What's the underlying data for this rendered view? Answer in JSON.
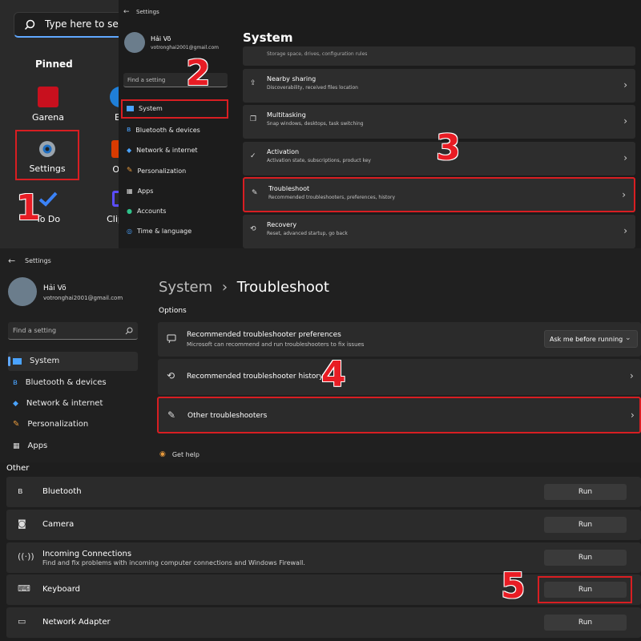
{
  "panel1": {
    "search_placeholder": "Type here to sea",
    "pinned_label": "Pinned",
    "apps": [
      {
        "label": "Garena"
      },
      {
        "label": "Ed"
      },
      {
        "label": "Settings"
      },
      {
        "label": "Offi"
      },
      {
        "label": "To Do"
      },
      {
        "label": "Clipch"
      }
    ]
  },
  "panel2": {
    "window_title": "Settings",
    "user_name": "Hải Võ",
    "user_email": "votronghai2001@gmail.com",
    "find_placeholder": "Find a setting",
    "nav": [
      "System",
      "Bluetooth & devices",
      "Network & internet",
      "Personalization",
      "Apps",
      "Accounts",
      "Time & language"
    ],
    "page_title": "System",
    "top_partial": "Storage space, drives, configuration rules",
    "cards": [
      {
        "title": "Nearby sharing",
        "subtitle": "Discoverability, received files location"
      },
      {
        "title": "Multitasking",
        "subtitle": "Snap windows, desktops, task switching"
      },
      {
        "title": "Activation",
        "subtitle": "Activation state, subscriptions, product key"
      },
      {
        "title": "Troubleshoot",
        "subtitle": "Recommended troubleshooters, preferences, history"
      },
      {
        "title": "Recovery",
        "subtitle": "Reset, advanced startup, go back"
      }
    ]
  },
  "panel3": {
    "window_title": "Settings",
    "user_name": "Hải Võ",
    "user_email": "votronghai2001@gmail.com",
    "find_placeholder": "Find a setting",
    "nav": [
      "System",
      "Bluetooth & devices",
      "Network & internet",
      "Personalization",
      "Apps"
    ],
    "breadcrumb_parent": "System",
    "breadcrumb_sep": "›",
    "breadcrumb_current": "Troubleshoot",
    "section_label": "Options",
    "pref_title": "Recommended troubleshooter preferences",
    "pref_subtitle": "Microsoft can recommend and run troubleshooters to fix issues",
    "pref_dropdown": "Ask me before running",
    "history_title": "Recommended troubleshooter history",
    "other_title": "Other troubleshooters",
    "get_help": "Get help"
  },
  "panel4": {
    "section_label": "Other",
    "run_label": "Run",
    "rows": [
      {
        "name": "Bluetooth",
        "desc": ""
      },
      {
        "name": "Camera",
        "desc": ""
      },
      {
        "name": "Incoming Connections",
        "desc": "Find and fix problems with incoming computer connections and Windows Firewall."
      },
      {
        "name": "Keyboard",
        "desc": ""
      },
      {
        "name": "Network Adapter",
        "desc": ""
      }
    ]
  },
  "steps": [
    "1",
    "2",
    "3",
    "4",
    "5"
  ],
  "colors": {
    "highlight": "#d81e22",
    "accent": "#60a8ff",
    "background": "#202020"
  }
}
